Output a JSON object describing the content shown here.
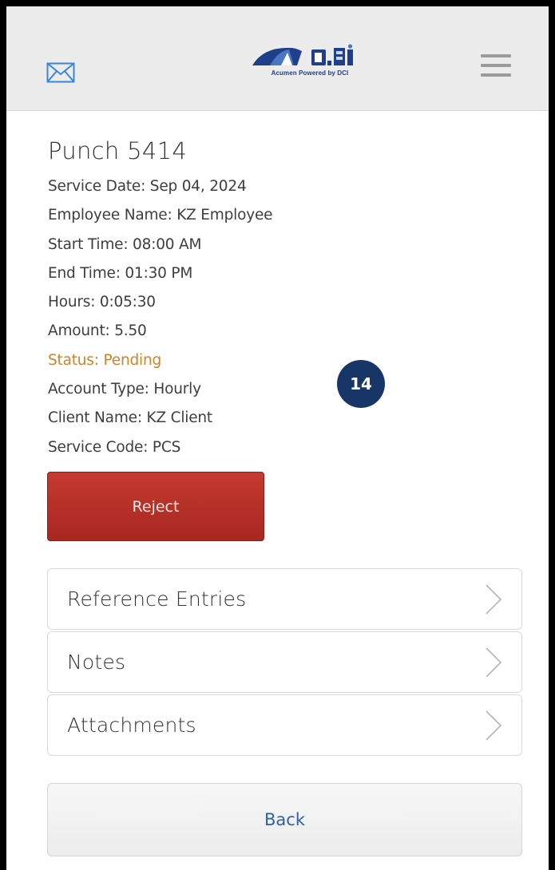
{
  "header": {
    "mail_icon": "mail-icon",
    "logo_caption": "Acumen Powered by DCI",
    "menu_icon": "hamburger-menu-icon"
  },
  "punch": {
    "title": "Punch 5414",
    "service_date": "Service Date: Sep 04, 2024",
    "employee_name": "Employee Name: KZ Employee",
    "start_time": "Start Time: 08:00 AM",
    "end_time": "End Time: 01:30 PM",
    "hours": "Hours: 0:05:30",
    "amount": "Amount: 5.50",
    "status": "Status: Pending",
    "account_type": "Account Type: Hourly",
    "client_name": "Client Name: KZ Client",
    "service_code": "Service Code: PCS"
  },
  "badge": {
    "number": "14"
  },
  "actions": {
    "reject_label": "Reject",
    "back_label": "Back"
  },
  "sections": [
    {
      "label": "Reference Entries"
    },
    {
      "label": "Notes"
    },
    {
      "label": "Attachments"
    }
  ],
  "colors": {
    "status_pending": "#d0822a",
    "reject_red": "#b7302a",
    "badge_navy": "#173566",
    "back_link_blue": "#2f62a4",
    "header_gray": "#ececec"
  }
}
